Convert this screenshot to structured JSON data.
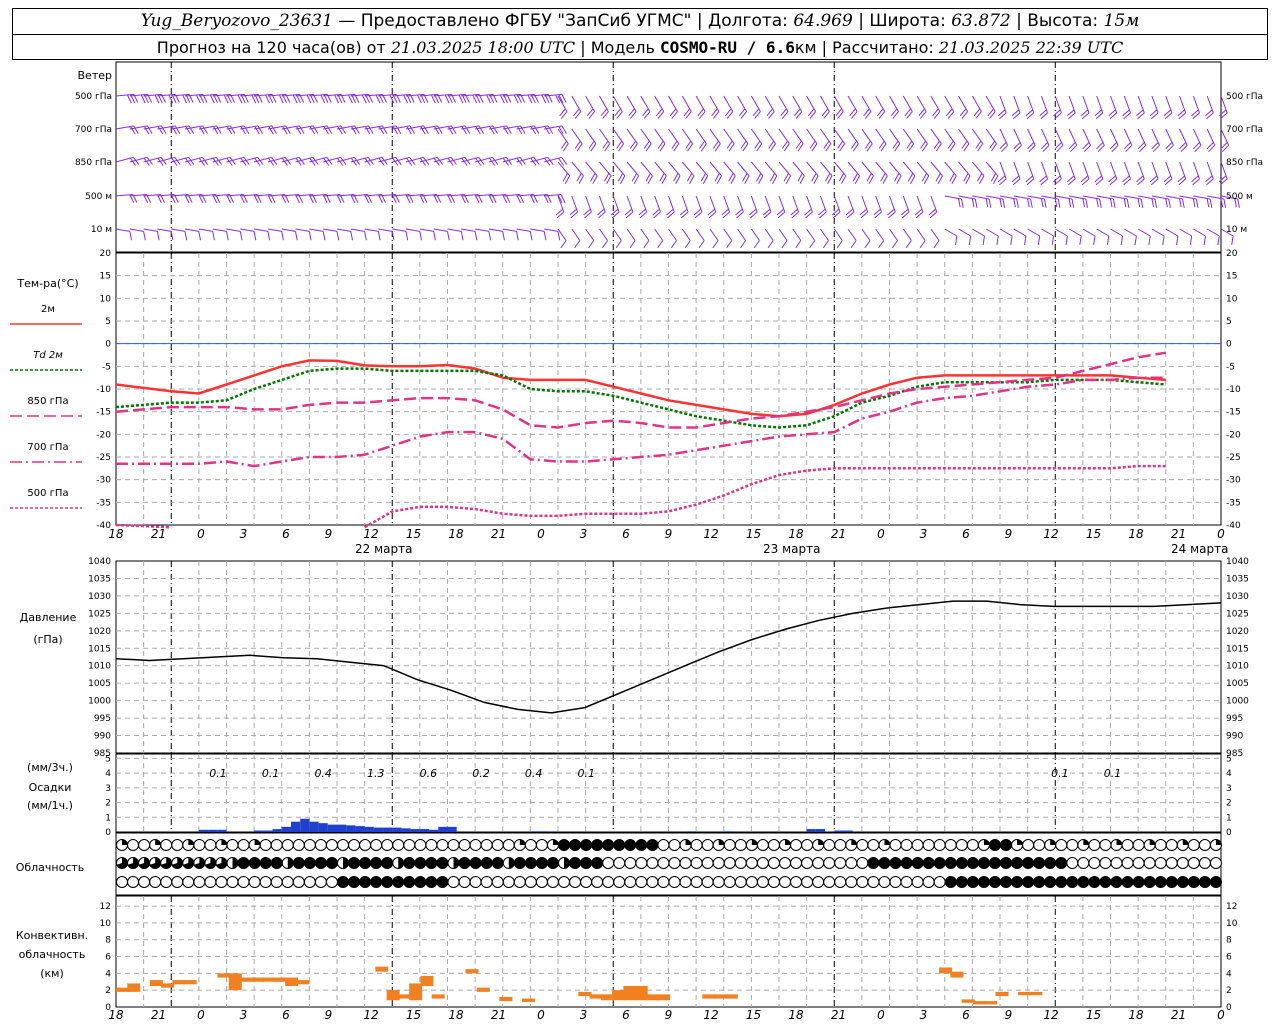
{
  "header": {
    "station": "Yug_Beryozovo_23631",
    "dash": "—",
    "provided_by": "Предоставлено ФГБУ \"ЗапСиб УГМС\"",
    "lon_label": "Долгота:",
    "lon": "64.969",
    "lat_label": "Широта:",
    "lat": "63.872",
    "alt_label": "Высота:",
    "alt": "15м",
    "forecast_prefix": "Прогноз на 120 часа(ов) от",
    "forecast_time": "21.03.2025 18:00 UTC",
    "model_label": "Модель",
    "model": "COSMO-RU / 6.6",
    "model_unit": "км",
    "calc_label": "Рассчитано:",
    "calc_time": "21.03.2025 22:39 UTC"
  },
  "time_axis": {
    "hour_labels": [
      "18",
      "21",
      "0",
      "3",
      "6",
      "9",
      "12",
      "15",
      "18",
      "21",
      "0",
      "3",
      "6",
      "9",
      "12",
      "15",
      "18",
      "21",
      "0",
      "3",
      "6",
      "9",
      "12",
      "15",
      "18",
      "21",
      "0"
    ],
    "date_labels": [
      "22 марта",
      "23 марта",
      "24 марта"
    ]
  },
  "wind": {
    "title": "Ветер",
    "levels": [
      "500 гПа",
      "700 гПа",
      "850 гПа",
      "500 м",
      "10  м"
    ],
    "color": "#8a2be2"
  },
  "temperature": {
    "title": "Тем-ра(°C)",
    "legend": [
      "2м",
      "Td 2м",
      "850 гПа",
      "700 гПа",
      "500 гПа"
    ],
    "ticks": [
      "20",
      "15",
      "10",
      "5",
      "0",
      "-5",
      "-10",
      "-15",
      "-20",
      "-25",
      "-30",
      "-35",
      "-40"
    ]
  },
  "pressure": {
    "title": "Давление",
    "unit": "(гПа)",
    "ticks": [
      "1040",
      "1035",
      "1030",
      "1025",
      "1020",
      "1015",
      "1010",
      "1005",
      "1000",
      "995",
      "990",
      "985"
    ]
  },
  "precip": {
    "title1": "(мм/3ч.)",
    "title2": "Осадки",
    "title3": "(мм/1ч.)",
    "ticks": [
      "5",
      "4",
      "3",
      "2",
      "1",
      "0"
    ],
    "labels": [
      "0.1",
      "0.1",
      "0.4",
      "1.3",
      "0.6",
      "0.2",
      "0.4",
      "0.1",
      "0.1",
      "0.1"
    ]
  },
  "cloud": {
    "title": "Облачность"
  },
  "convective": {
    "title1": "Конвективн.",
    "title2": "облачность",
    "title3": "(км)",
    "ticks": [
      "12",
      "10",
      "8",
      "6",
      "4",
      "2",
      "0"
    ]
  },
  "chart_data": [
    {
      "type": "line",
      "title": "Тем-ра(°C)",
      "ylim": [
        -40,
        20
      ],
      "x_hours": [
        0,
        6,
        9,
        12,
        15,
        18,
        21,
        24,
        27,
        30,
        33,
        36,
        39,
        42,
        45,
        48,
        51,
        54,
        57,
        60,
        63,
        66,
        69,
        72,
        75,
        78,
        81,
        84,
        87,
        90,
        93,
        96,
        99,
        102,
        105,
        108,
        111,
        114,
        117,
        120
      ],
      "series": [
        {
          "name": "2м",
          "color": "#ff3333",
          "values": [
            -9,
            -10.5,
            -11,
            -9,
            -7,
            -5,
            -3.7,
            -3.8,
            -4.8,
            -5,
            -5,
            -4.7,
            -5.5,
            -7.5,
            -8,
            -8,
            -8,
            -9.5,
            -11,
            -12.5,
            -13.5,
            -14.5,
            -15.5,
            -16,
            -15.5,
            -13.5,
            -11,
            -9,
            -7.5,
            -7,
            -7,
            -7,
            -7,
            -7,
            -7,
            -7,
            -7.5,
            -8
          ]
        },
        {
          "name": "Td 2м",
          "color": "#007700",
          "values": [
            -14,
            -13,
            -13,
            -12.5,
            -10,
            -8,
            -6,
            -5.5,
            -5.5,
            -6,
            -6,
            -6,
            -6,
            -7,
            -10,
            -10.5,
            -10.5,
            -11.5,
            -13,
            -14.5,
            -16,
            -17,
            -18,
            -18.5,
            -18,
            -16,
            -13,
            -11.5,
            -9.5,
            -8.5,
            -8.5,
            -8.5,
            -8.5,
            -8,
            -8,
            -8,
            -8.5,
            -9
          ]
        },
        {
          "name": "850 гПа",
          "color": "#e0338a",
          "values": [
            -15,
            -14,
            -14,
            -14,
            -14.5,
            -14.5,
            -13.5,
            -13,
            -13,
            -12.5,
            -12,
            -12,
            -12.5,
            -14.5,
            -18,
            -18.5,
            -17.5,
            -17,
            -17.5,
            -18.5,
            -18.5,
            -17.5,
            -16.5,
            -16,
            -15,
            -14,
            -12.5,
            -11,
            -10,
            -9.5,
            -9,
            -8.5,
            -8,
            -7.5,
            -6,
            -4.5,
            -3,
            -2
          ]
        },
        {
          "name": "700 гПа",
          "color": "#e0338a",
          "values": [
            -26.5,
            -26.5,
            -26.5,
            -26,
            -27,
            -26,
            -25,
            -25,
            -24.5,
            -22.5,
            -20.5,
            -19.5,
            -19.5,
            -21,
            -25.5,
            -26,
            -26,
            -25.5,
            -25,
            -24.5,
            -23.5,
            -22.5,
            -21.5,
            -20.5,
            -20,
            -19.5,
            -16.5,
            -15,
            -13,
            -12,
            -11.5,
            -10.5,
            -9.5,
            -9,
            -8,
            -8,
            -7.5,
            -7.5
          ]
        },
        {
          "name": "500 гПа",
          "color": "#e0338a",
          "values": [
            -40,
            -40.5,
            -44,
            -44,
            -44,
            -44,
            -44,
            -44,
            -40.5,
            -37,
            -36,
            -36,
            -36.5,
            -37.5,
            -38,
            -38,
            -37.5,
            -37.5,
            -37.5,
            -37,
            -35.5,
            -33.5,
            -31,
            -29,
            -28,
            -27.5,
            -27.5,
            -27.5,
            -27.5,
            -27.5,
            -27.5,
            -27.5,
            -27.5,
            -27.5,
            -27.5,
            -27.5,
            -27,
            -27
          ]
        }
      ]
    },
    {
      "type": "line",
      "title": "Давление",
      "ylim": [
        985,
        1040
      ],
      "x_hours": [
        0,
        3,
        6,
        12,
        18,
        24,
        30,
        36,
        42,
        48,
        51,
        54,
        57,
        60,
        66,
        72,
        78,
        84,
        90,
        96,
        102,
        108,
        114,
        117,
        120
      ],
      "series": [
        {
          "name": "Давление",
          "color": "#000000",
          "values": [
            1012,
            1011.5,
            1012,
            1012.5,
            1013,
            1012.3,
            1012,
            1011,
            1010,
            1006,
            1003,
            999.5,
            997.5,
            996.5,
            998,
            1002,
            1006,
            1010,
            1014,
            1017.5,
            1020.5,
            1023,
            1025,
            1026.5,
            1027.5,
            1028.5,
            1028.5,
            1027.5,
            1027,
            1027,
            1027,
            1027,
            1027.5,
            1028
          ]
        }
      ]
    },
    {
      "type": "bar",
      "title": "Осадки",
      "ylim": [
        0,
        5
      ],
      "x_hours": [
        9,
        10,
        11,
        15,
        16,
        17,
        18,
        19,
        20,
        21,
        22,
        23,
        24,
        25,
        26,
        27,
        28,
        29,
        30,
        31,
        32,
        33,
        34,
        35,
        36,
        45,
        46,
        62,
        66,
        75,
        76,
        78,
        79
      ],
      "values": [
        0.15,
        0.15,
        0.15,
        0.1,
        0.1,
        0.2,
        0.35,
        0.7,
        0.9,
        0.7,
        0.6,
        0.5,
        0.5,
        0.45,
        0.4,
        0.35,
        0.3,
        0.3,
        0.3,
        0.25,
        0.2,
        0.2,
        0.15,
        0.35,
        0.35,
        0.05,
        0.05,
        0.05,
        0.05,
        0.2,
        0.2,
        0.1,
        0.1
      ]
    },
    {
      "type": "bar",
      "title": "Конвективн. облачность (км)",
      "ylim": [
        0,
        12
      ],
      "bars": [
        {
          "x": 0,
          "bottom": 1.8,
          "top": 2.3
        },
        {
          "x": 1,
          "bottom": 1.8,
          "top": 2.8
        },
        {
          "x": 3,
          "bottom": 2.5,
          "top": 3.2
        },
        {
          "x": 4,
          "bottom": 2.3,
          "top": 2.8
        },
        {
          "x": 5,
          "bottom": 2.7,
          "top": 3.2
        },
        {
          "x": 6,
          "bottom": 2.7,
          "top": 3.2
        },
        {
          "x": 9,
          "bottom": 3.5,
          "top": 4.0
        },
        {
          "x": 10,
          "bottom": 2.0,
          "top": 4.0
        },
        {
          "x": 11,
          "bottom": 3.0,
          "top": 3.5
        },
        {
          "x": 12,
          "bottom": 3.0,
          "top": 3.5
        },
        {
          "x": 13,
          "bottom": 3.0,
          "top": 3.5
        },
        {
          "x": 14,
          "bottom": 3.0,
          "top": 3.5
        },
        {
          "x": 15,
          "bottom": 2.5,
          "top": 3.5
        },
        {
          "x": 16,
          "bottom": 2.7,
          "top": 3.2
        },
        {
          "x": 23,
          "bottom": 4.2,
          "top": 4.8
        },
        {
          "x": 24,
          "bottom": 0.8,
          "top": 2.0
        },
        {
          "x": 25,
          "bottom": 1.0,
          "top": 1.5
        },
        {
          "x": 26,
          "bottom": 0.8,
          "top": 2.8
        },
        {
          "x": 27,
          "bottom": 2.5,
          "top": 3.7
        },
        {
          "x": 28,
          "bottom": 1.0,
          "top": 1.5
        },
        {
          "x": 31,
          "bottom": 4.0,
          "top": 4.5
        },
        {
          "x": 32,
          "bottom": 1.8,
          "top": 2.3
        },
        {
          "x": 34,
          "bottom": 0.7,
          "top": 1.2
        },
        {
          "x": 36,
          "bottom": 0.6,
          "top": 1.0
        },
        {
          "x": 41,
          "bottom": 1.3,
          "top": 1.8
        },
        {
          "x": 42,
          "bottom": 1.0,
          "top": 1.5
        },
        {
          "x": 43,
          "bottom": 0.8,
          "top": 1.5
        },
        {
          "x": 44,
          "bottom": 0.8,
          "top": 2.0
        },
        {
          "x": 45,
          "bottom": 0.8,
          "top": 2.5
        },
        {
          "x": 46,
          "bottom": 0.8,
          "top": 2.5
        },
        {
          "x": 47,
          "bottom": 0.8,
          "top": 1.5
        },
        {
          "x": 48,
          "bottom": 0.8,
          "top": 1.5
        },
        {
          "x": 52,
          "bottom": 1.0,
          "top": 1.5
        },
        {
          "x": 53,
          "bottom": 1.0,
          "top": 1.5
        },
        {
          "x": 54,
          "bottom": 1.0,
          "top": 1.5
        },
        {
          "x": 73,
          "bottom": 4.0,
          "top": 4.7
        },
        {
          "x": 74,
          "bottom": 3.5,
          "top": 4.2
        },
        {
          "x": 75,
          "bottom": 0.5,
          "top": 0.9
        },
        {
          "x": 76,
          "bottom": 0.3,
          "top": 0.7
        },
        {
          "x": 77,
          "bottom": 0.3,
          "top": 0.7
        },
        {
          "x": 78,
          "bottom": 1.3,
          "top": 1.8
        },
        {
          "x": 80,
          "bottom": 1.4,
          "top": 1.8
        },
        {
          "x": 81,
          "bottom": 1.4,
          "top": 1.8
        }
      ]
    }
  ]
}
